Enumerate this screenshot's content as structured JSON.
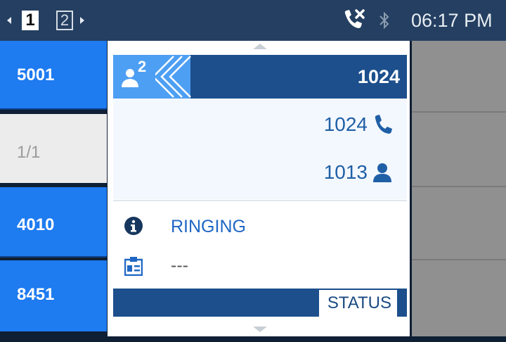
{
  "status_bar": {
    "pages": [
      "1",
      "2"
    ],
    "active_page": "1",
    "time": "06:17 PM",
    "icons": [
      "missed-call-icon",
      "bluetooth-icon"
    ]
  },
  "line_keys": [
    {
      "label": "5001",
      "state": "active"
    },
    {
      "label": "1/1",
      "state": "inactive"
    },
    {
      "label": "4010",
      "state": "active"
    },
    {
      "label": "8451",
      "state": "active"
    }
  ],
  "call": {
    "conference_count": "2",
    "header_number": "1024",
    "participants": [
      {
        "number": "1024",
        "icon": "phone-icon"
      },
      {
        "number": "1013",
        "icon": "person-icon"
      }
    ],
    "status": "RINGING",
    "detail": "---"
  },
  "softkeys": {
    "status_label": "STATUS"
  },
  "colors": {
    "status_bar": "#243f61",
    "line_key_active": "#1e7bf0",
    "header_dark": "#1c4f8c",
    "header_light": "#4d9ff3",
    "accent_text": "#1f67c4"
  }
}
